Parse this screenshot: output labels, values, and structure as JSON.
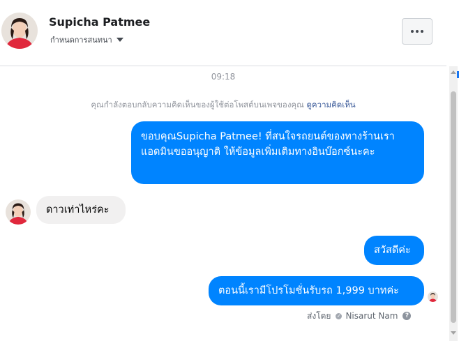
{
  "header": {
    "contact_name": "Supicha Patmee",
    "customize_label": "กำหนดการสนทนา"
  },
  "conversation": {
    "timestamp": "09:18",
    "notice_text": "คุณกำลังตอบกลับความคิดเห็นของผู้ใช้ต่อโพสต์บนเพจของคุณ",
    "notice_link": "ดูความคิดเห็น",
    "messages": [
      {
        "direction": "outgoing",
        "text": "ขอบคุณSupicha Patmee! ที่สนใจรถยนต์ของทางร้านเรา แอดมินขออนุญาติ ให้ข้อมูลเพิ่มเติมทางอินบ๊อกซ์นะคะ"
      },
      {
        "direction": "incoming",
        "text": "ดาวเท่าไหร่คะ"
      },
      {
        "direction": "outgoing",
        "text": "สวัสดีค่ะ"
      },
      {
        "direction": "outgoing",
        "text": "ตอนนี้เรามีโปรโมชั่นรับรถ 1,999 บาทค่ะ"
      }
    ],
    "sent_by_label": "ส่งโดย",
    "sent_by_name": "Nisarut Nam"
  },
  "colors": {
    "outgoing_bubble": "#0084ff",
    "incoming_bubble": "#f1f0f0",
    "link": "#385898"
  }
}
